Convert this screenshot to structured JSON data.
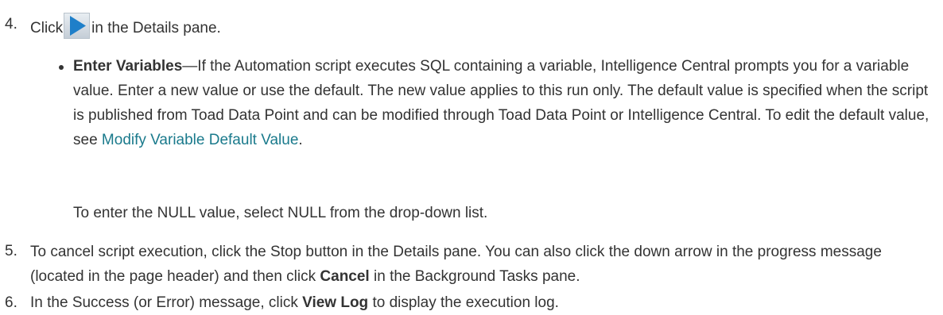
{
  "step4": {
    "number": "4.",
    "click": "Click",
    "after": "in the Details pane.",
    "icon": "play-icon",
    "icon_color": "#1e7fc9"
  },
  "bullet": {
    "term": "Enter Variables",
    "text": "—If the Automation script executes SQL containing a variable, Intelligence Central prompts you for a variable value. Enter a new value or use the default. The new value applies to this run only. The default value is specified when the script is published from Toad Data Point and can be modified through Toad Data Point or Intelligence Central. To edit the default value, see ",
    "link_text": "Modify Variable Default Value",
    "end": "."
  },
  "null_note": "To enter the NULL value, select NULL from the drop-down list.",
  "step5": {
    "number": "5.",
    "text_before": "To cancel script execution, click the Stop button in the Details pane. You can also click the down arrow in the progress message (located in the page header) and then click ",
    "bold": "Cancel",
    "text_after": " in the Background Tasks pane."
  },
  "step6": {
    "number": "6.",
    "text_before": "In the Success (or Error) message, click ",
    "bold": "View Log",
    "text_after": " to display the execution log."
  },
  "colors": {
    "text": "#333333",
    "link": "#1a7a8c",
    "icon": "#1e7fc9"
  }
}
